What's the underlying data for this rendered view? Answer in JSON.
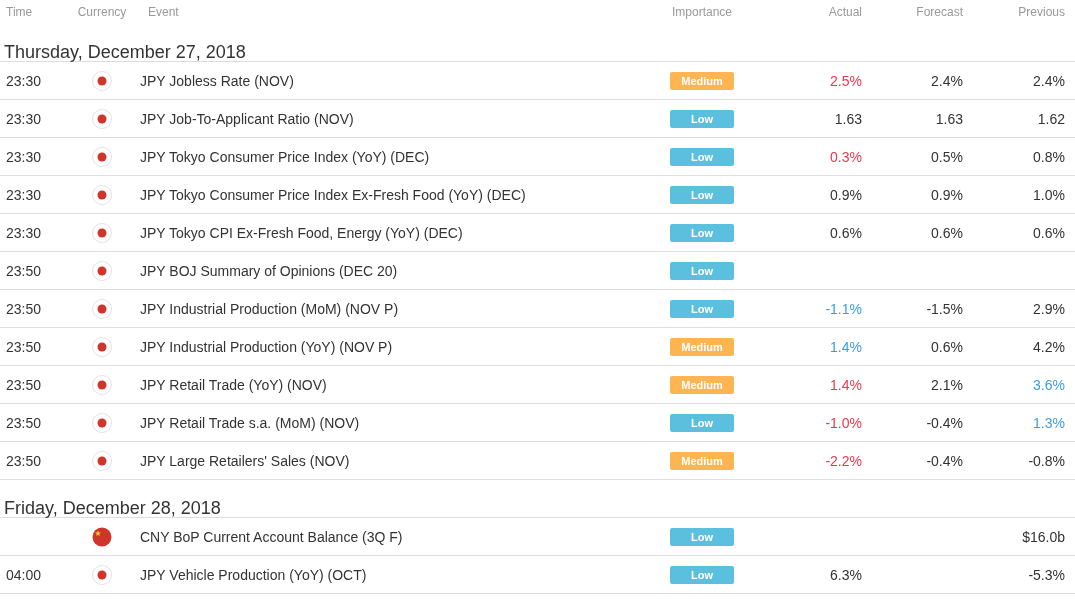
{
  "columns": [
    "Time",
    "Currency",
    "Event",
    "Importance",
    "Actual",
    "Forecast",
    "Previous"
  ],
  "days": [
    {
      "date": "Thursday, December 27, 2018",
      "events": [
        {
          "time": "23:30",
          "flag": {
            "kind": "jp"
          },
          "event": "JPY Jobless Rate (NOV)",
          "importance": {
            "label": "Medium",
            "kind": "medium"
          },
          "actual": {
            "text": "2.5%",
            "color": "#e8384f"
          },
          "forecast": "2.4%",
          "previous": {
            "text": "2.4%",
            "color": "#333333"
          }
        },
        {
          "time": "23:30",
          "flag": {
            "kind": "jp"
          },
          "event": "JPY Job-To-Applicant Ratio (NOV)",
          "importance": {
            "label": "Low",
            "kind": "low"
          },
          "actual": {
            "text": "1.63",
            "color": "#333333"
          },
          "forecast": "1.63",
          "previous": {
            "text": "1.62",
            "color": "#333333"
          }
        },
        {
          "time": "23:30",
          "flag": {
            "kind": "jp"
          },
          "event": "JPY Tokyo Consumer Price Index (YoY) (DEC)",
          "importance": {
            "label": "Low",
            "kind": "low"
          },
          "actual": {
            "text": "0.3%",
            "color": "#e8384f"
          },
          "forecast": "0.5%",
          "previous": {
            "text": "0.8%",
            "color": "#333333"
          }
        },
        {
          "time": "23:30",
          "flag": {
            "kind": "jp"
          },
          "event": "JPY Tokyo Consumer Price Index Ex-Fresh Food (YoY) (DEC)",
          "importance": {
            "label": "Low",
            "kind": "low"
          },
          "actual": {
            "text": "0.9%",
            "color": "#333333"
          },
          "forecast": "0.9%",
          "previous": {
            "text": "1.0%",
            "color": "#333333"
          }
        },
        {
          "time": "23:30",
          "flag": {
            "kind": "jp"
          },
          "event": "JPY Tokyo CPI Ex-Fresh Food, Energy (YoY) (DEC)",
          "importance": {
            "label": "Low",
            "kind": "low"
          },
          "actual": {
            "text": "0.6%",
            "color": "#333333"
          },
          "forecast": "0.6%",
          "previous": {
            "text": "0.6%",
            "color": "#333333"
          }
        },
        {
          "time": "23:50",
          "flag": {
            "kind": "jp"
          },
          "event": "JPY BOJ Summary of Opinions (DEC 20)",
          "importance": {
            "label": "Low",
            "kind": "low"
          }
        },
        {
          "time": "23:50",
          "flag": {
            "kind": "jp"
          },
          "event": "JPY Industrial Production (MoM) (NOV P)",
          "importance": {
            "label": "Low",
            "kind": "low"
          },
          "actual": {
            "text": "-1.1%",
            "color": "#3c9ce0"
          },
          "forecast": "-1.5%",
          "previous": {
            "text": "2.9%",
            "color": "#333333"
          }
        },
        {
          "time": "23:50",
          "flag": {
            "kind": "jp"
          },
          "event": "JPY Industrial Production (YoY) (NOV P)",
          "importance": {
            "label": "Medium",
            "kind": "medium"
          },
          "actual": {
            "text": "1.4%",
            "color": "#3c9ce0"
          },
          "forecast": "0.6%",
          "previous": {
            "text": "4.2%",
            "color": "#333333"
          }
        },
        {
          "time": "23:50",
          "flag": {
            "kind": "jp"
          },
          "event": "JPY Retail Trade (YoY) (NOV)",
          "importance": {
            "label": "Medium",
            "kind": "medium"
          },
          "actual": {
            "text": "1.4%",
            "color": "#e8384f"
          },
          "forecast": "2.1%",
          "previous": {
            "text": "3.6%",
            "color": "#3c9ce0"
          }
        },
        {
          "time": "23:50",
          "flag": {
            "kind": "jp"
          },
          "event": "JPY Retail Trade s.a. (MoM) (NOV)",
          "importance": {
            "label": "Low",
            "kind": "low"
          },
          "actual": {
            "text": "-1.0%",
            "color": "#e8384f"
          },
          "forecast": "-0.4%",
          "previous": {
            "text": "1.3%",
            "color": "#3c9ce0"
          }
        },
        {
          "time": "23:50",
          "flag": {
            "kind": "jp"
          },
          "event": "JPY Large Retailers' Sales (NOV)",
          "importance": {
            "label": "Medium",
            "kind": "medium"
          },
          "actual": {
            "text": "-2.2%",
            "color": "#e8384f"
          },
          "forecast": "-0.4%",
          "previous": {
            "text": "-0.8%",
            "color": "#333333"
          }
        }
      ]
    },
    {
      "date": "Friday, December 28, 2018",
      "events": [
        {
          "flag": {
            "kind": "cn"
          },
          "event": "CNY BoP Current Account Balance (3Q F)",
          "importance": {
            "label": "Low",
            "kind": "low"
          },
          "previous": {
            "text": "$16.0b",
            "color": "#333333"
          }
        },
        {
          "time": "04:00",
          "flag": {
            "kind": "jp"
          },
          "event": "JPY Vehicle Production (YoY) (OCT)",
          "importance": {
            "label": "Low",
            "kind": "low"
          },
          "actual": {
            "text": "6.3%",
            "color": "#333333"
          },
          "previous": {
            "text": "-5.3%",
            "color": "#333333"
          }
        }
      ]
    }
  ]
}
